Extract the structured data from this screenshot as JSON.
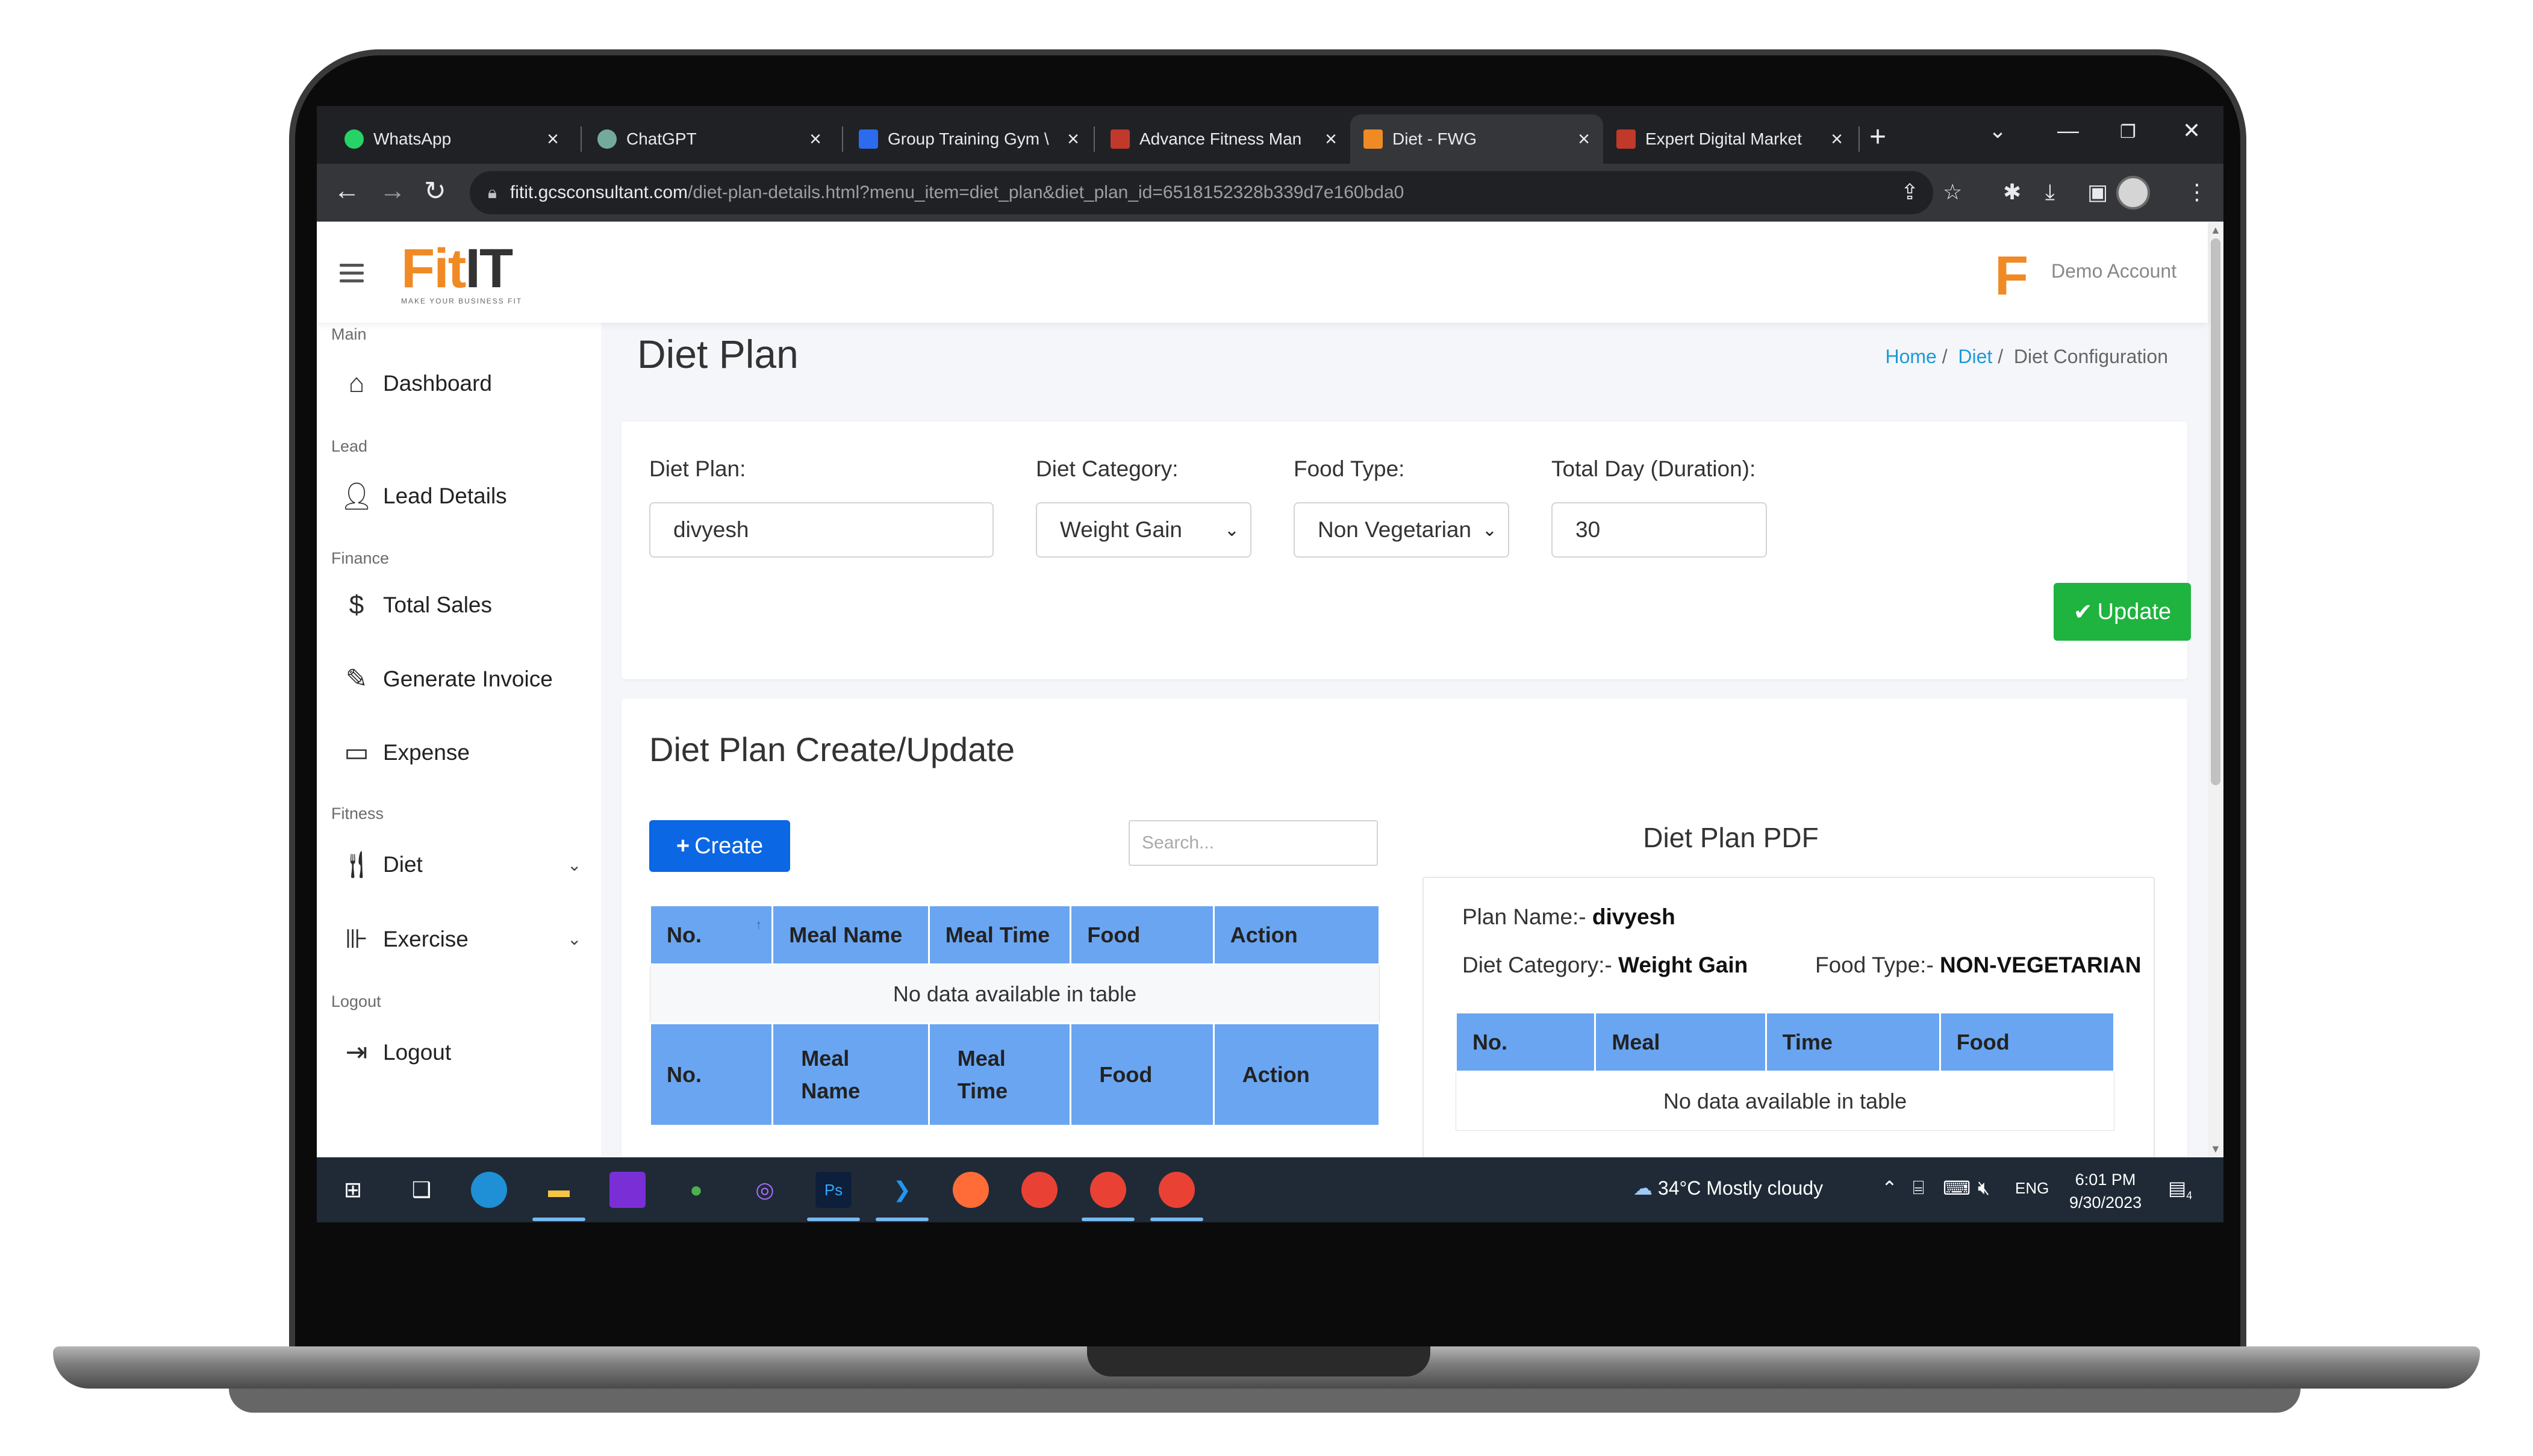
{
  "browser": {
    "tabs": [
      {
        "label": "WhatsApp",
        "icon": "whatsapp-icon",
        "color": "#25d366"
      },
      {
        "label": "ChatGPT",
        "icon": "chatgpt-icon",
        "color": "#74aa9c"
      },
      {
        "label": "Group Training Gym \\",
        "icon": "forms-icon",
        "color": "#2c6bed"
      },
      {
        "label": "Advance Fitness Man",
        "icon": "fitness-icon",
        "color": "#c0392b"
      },
      {
        "label": "Diet - FWG",
        "icon": "fitit-icon",
        "color": "#f08a24"
      },
      {
        "label": "Expert Digital Market",
        "icon": "fitness-icon",
        "color": "#c0392b"
      }
    ],
    "url_host": "fitit.gcsconsultant.com",
    "url_path": "/diet-plan-details.html?menu_item=diet_plan&diet_plan_id=6518152328b339d7e160bda0"
  },
  "header": {
    "logo_main": "Fit",
    "logo_accent": "IT",
    "logo_tagline": "MAKE YOUR BUSINESS FIT",
    "account_logo": "F",
    "account_name": "Demo Account"
  },
  "sidebar": {
    "sections": {
      "main": "Main",
      "lead": "Lead",
      "finance": "Finance",
      "fitness": "Fitness",
      "logout": "Logout"
    },
    "items": {
      "dashboard": "Dashboard",
      "lead_details": "Lead Details",
      "total_sales": "Total Sales",
      "generate_invoice": "Generate Invoice",
      "expense": "Expense",
      "diet": "Diet",
      "exercise": "Exercise",
      "logout": "Logout"
    }
  },
  "page": {
    "title": "Diet Plan",
    "breadcrumb": {
      "home": "Home",
      "diet": "Diet",
      "current": "Diet Configuration",
      "sep": "/"
    }
  },
  "form": {
    "diet_plan_label": "Diet Plan:",
    "diet_plan_value": "divyesh",
    "diet_category_label": "Diet Category:",
    "diet_category_value": "Weight Gain",
    "food_type_label": "Food Type:",
    "food_type_value": "Non Vegetarian",
    "duration_label": "Total Day (Duration):",
    "duration_value": "30",
    "update_button": "Update"
  },
  "editor": {
    "title": "Diet Plan Create/Update",
    "create_button": "Create",
    "search_placeholder": "Search...",
    "table": {
      "headers": [
        "No.",
        "Meal Name",
        "Meal Time",
        "Food",
        "Action"
      ],
      "footer_headers": [
        "No.",
        "Meal Name",
        "Meal Time",
        "Food",
        "Action"
      ],
      "empty": "No data available in table"
    }
  },
  "pdf": {
    "title": "Diet Plan PDF",
    "plan_name_label": "Plan Name:-",
    "plan_name_value": "divyesh",
    "category_label": "Diet Category:-",
    "category_value": "Weight Gain",
    "food_type_label": "Food Type:-",
    "food_type_value": "NON-VEGETARIAN",
    "table": {
      "headers": [
        "No.",
        "Meal",
        "Time",
        "Food"
      ],
      "empty": "No data available in table"
    }
  },
  "taskbar": {
    "weather": "34°C  Mostly cloudy",
    "lang": "ENG",
    "time": "6:01 PM",
    "date": "9/30/2023",
    "notifications": "4"
  },
  "colors": {
    "accent": "#f08a24",
    "link": "#1d9bd7",
    "primary_button": "#0b67e3",
    "success_button": "#1fb33f",
    "table_header": "#6aa5f1"
  }
}
